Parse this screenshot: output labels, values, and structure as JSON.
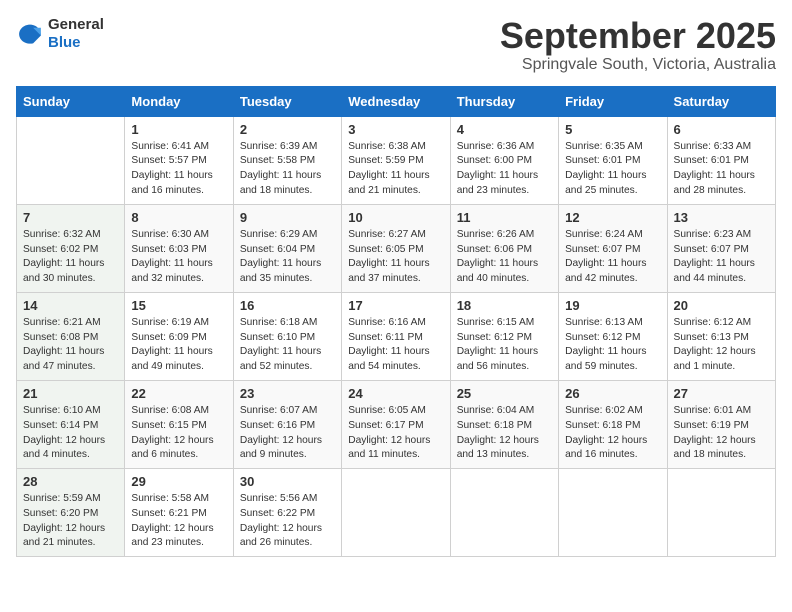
{
  "logo": {
    "general": "General",
    "blue": "Blue"
  },
  "header": {
    "month": "September 2025",
    "location": "Springvale South, Victoria, Australia"
  },
  "weekdays": [
    "Sunday",
    "Monday",
    "Tuesday",
    "Wednesday",
    "Thursday",
    "Friday",
    "Saturday"
  ],
  "weeks": [
    [
      {
        "day": "",
        "sunrise": "",
        "sunset": "",
        "daylight": ""
      },
      {
        "day": "1",
        "sunrise": "Sunrise: 6:41 AM",
        "sunset": "Sunset: 5:57 PM",
        "daylight": "Daylight: 11 hours and 16 minutes."
      },
      {
        "day": "2",
        "sunrise": "Sunrise: 6:39 AM",
        "sunset": "Sunset: 5:58 PM",
        "daylight": "Daylight: 11 hours and 18 minutes."
      },
      {
        "day": "3",
        "sunrise": "Sunrise: 6:38 AM",
        "sunset": "Sunset: 5:59 PM",
        "daylight": "Daylight: 11 hours and 21 minutes."
      },
      {
        "day": "4",
        "sunrise": "Sunrise: 6:36 AM",
        "sunset": "Sunset: 6:00 PM",
        "daylight": "Daylight: 11 hours and 23 minutes."
      },
      {
        "day": "5",
        "sunrise": "Sunrise: 6:35 AM",
        "sunset": "Sunset: 6:01 PM",
        "daylight": "Daylight: 11 hours and 25 minutes."
      },
      {
        "day": "6",
        "sunrise": "Sunrise: 6:33 AM",
        "sunset": "Sunset: 6:01 PM",
        "daylight": "Daylight: 11 hours and 28 minutes."
      }
    ],
    [
      {
        "day": "7",
        "sunrise": "Sunrise: 6:32 AM",
        "sunset": "Sunset: 6:02 PM",
        "daylight": "Daylight: 11 hours and 30 minutes."
      },
      {
        "day": "8",
        "sunrise": "Sunrise: 6:30 AM",
        "sunset": "Sunset: 6:03 PM",
        "daylight": "Daylight: 11 hours and 32 minutes."
      },
      {
        "day": "9",
        "sunrise": "Sunrise: 6:29 AM",
        "sunset": "Sunset: 6:04 PM",
        "daylight": "Daylight: 11 hours and 35 minutes."
      },
      {
        "day": "10",
        "sunrise": "Sunrise: 6:27 AM",
        "sunset": "Sunset: 6:05 PM",
        "daylight": "Daylight: 11 hours and 37 minutes."
      },
      {
        "day": "11",
        "sunrise": "Sunrise: 6:26 AM",
        "sunset": "Sunset: 6:06 PM",
        "daylight": "Daylight: 11 hours and 40 minutes."
      },
      {
        "day": "12",
        "sunrise": "Sunrise: 6:24 AM",
        "sunset": "Sunset: 6:07 PM",
        "daylight": "Daylight: 11 hours and 42 minutes."
      },
      {
        "day": "13",
        "sunrise": "Sunrise: 6:23 AM",
        "sunset": "Sunset: 6:07 PM",
        "daylight": "Daylight: 11 hours and 44 minutes."
      }
    ],
    [
      {
        "day": "14",
        "sunrise": "Sunrise: 6:21 AM",
        "sunset": "Sunset: 6:08 PM",
        "daylight": "Daylight: 11 hours and 47 minutes."
      },
      {
        "day": "15",
        "sunrise": "Sunrise: 6:19 AM",
        "sunset": "Sunset: 6:09 PM",
        "daylight": "Daylight: 11 hours and 49 minutes."
      },
      {
        "day": "16",
        "sunrise": "Sunrise: 6:18 AM",
        "sunset": "Sunset: 6:10 PM",
        "daylight": "Daylight: 11 hours and 52 minutes."
      },
      {
        "day": "17",
        "sunrise": "Sunrise: 6:16 AM",
        "sunset": "Sunset: 6:11 PM",
        "daylight": "Daylight: 11 hours and 54 minutes."
      },
      {
        "day": "18",
        "sunrise": "Sunrise: 6:15 AM",
        "sunset": "Sunset: 6:12 PM",
        "daylight": "Daylight: 11 hours and 56 minutes."
      },
      {
        "day": "19",
        "sunrise": "Sunrise: 6:13 AM",
        "sunset": "Sunset: 6:12 PM",
        "daylight": "Daylight: 11 hours and 59 minutes."
      },
      {
        "day": "20",
        "sunrise": "Sunrise: 6:12 AM",
        "sunset": "Sunset: 6:13 PM",
        "daylight": "Daylight: 12 hours and 1 minute."
      }
    ],
    [
      {
        "day": "21",
        "sunrise": "Sunrise: 6:10 AM",
        "sunset": "Sunset: 6:14 PM",
        "daylight": "Daylight: 12 hours and 4 minutes."
      },
      {
        "day": "22",
        "sunrise": "Sunrise: 6:08 AM",
        "sunset": "Sunset: 6:15 PM",
        "daylight": "Daylight: 12 hours and 6 minutes."
      },
      {
        "day": "23",
        "sunrise": "Sunrise: 6:07 AM",
        "sunset": "Sunset: 6:16 PM",
        "daylight": "Daylight: 12 hours and 9 minutes."
      },
      {
        "day": "24",
        "sunrise": "Sunrise: 6:05 AM",
        "sunset": "Sunset: 6:17 PM",
        "daylight": "Daylight: 12 hours and 11 minutes."
      },
      {
        "day": "25",
        "sunrise": "Sunrise: 6:04 AM",
        "sunset": "Sunset: 6:18 PM",
        "daylight": "Daylight: 12 hours and 13 minutes."
      },
      {
        "day": "26",
        "sunrise": "Sunrise: 6:02 AM",
        "sunset": "Sunset: 6:18 PM",
        "daylight": "Daylight: 12 hours and 16 minutes."
      },
      {
        "day": "27",
        "sunrise": "Sunrise: 6:01 AM",
        "sunset": "Sunset: 6:19 PM",
        "daylight": "Daylight: 12 hours and 18 minutes."
      }
    ],
    [
      {
        "day": "28",
        "sunrise": "Sunrise: 5:59 AM",
        "sunset": "Sunset: 6:20 PM",
        "daylight": "Daylight: 12 hours and 21 minutes."
      },
      {
        "day": "29",
        "sunrise": "Sunrise: 5:58 AM",
        "sunset": "Sunset: 6:21 PM",
        "daylight": "Daylight: 12 hours and 23 minutes."
      },
      {
        "day": "30",
        "sunrise": "Sunrise: 5:56 AM",
        "sunset": "Sunset: 6:22 PM",
        "daylight": "Daylight: 12 hours and 26 minutes."
      },
      {
        "day": "",
        "sunrise": "",
        "sunset": "",
        "daylight": ""
      },
      {
        "day": "",
        "sunrise": "",
        "sunset": "",
        "daylight": ""
      },
      {
        "day": "",
        "sunrise": "",
        "sunset": "",
        "daylight": ""
      },
      {
        "day": "",
        "sunrise": "",
        "sunset": "",
        "daylight": ""
      }
    ]
  ]
}
